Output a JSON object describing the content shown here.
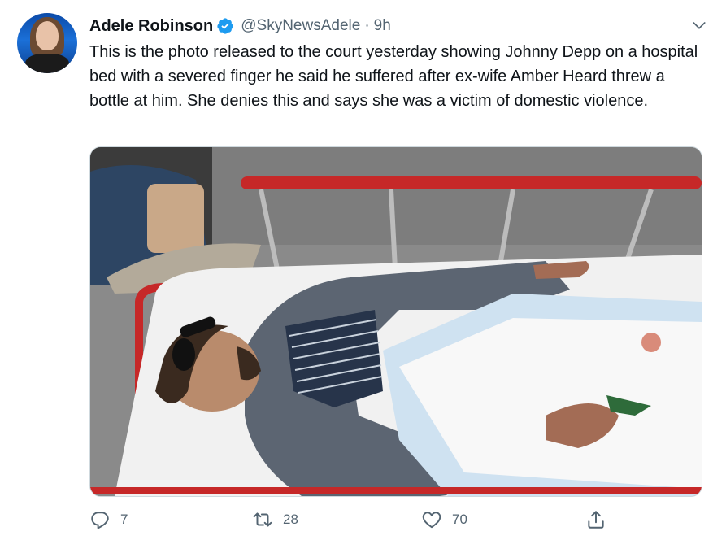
{
  "author": {
    "name": "Adele Robinson",
    "handle": "@SkyNewsAdele",
    "separator": "·",
    "time": "9h",
    "verified": true
  },
  "tweet_text": "This is the photo released to the court yesterday showing Johnny Depp on a hospital bed with a severed finger he said he suffered after ex-wife Amber Heard threw a bottle at him. She denies this and says she was a victim of domestic violence.",
  "actions": {
    "reply_count": "7",
    "retweet_count": "28",
    "like_count": "70"
  },
  "icons": [
    "verified-badge-icon",
    "chevron-down-icon",
    "reply-icon",
    "retweet-icon",
    "like-icon",
    "share-icon"
  ],
  "colors": {
    "verified_blue": "#1d9bf0",
    "secondary_text": "#536471",
    "primary_text": "#0f1419"
  }
}
